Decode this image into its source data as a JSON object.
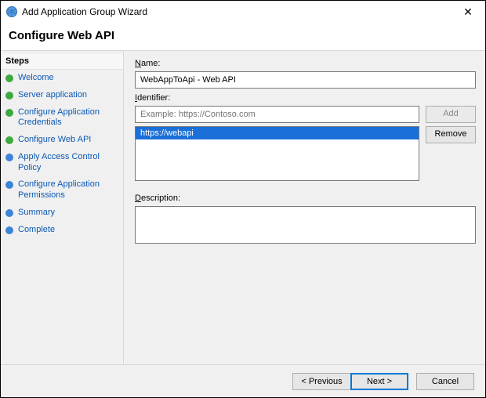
{
  "window": {
    "title": "Add Application Group Wizard",
    "close_glyph": "✕"
  },
  "heading": "Configure Web API",
  "sidebar": {
    "header": "Steps",
    "items": [
      {
        "label": "Welcome",
        "state": "done"
      },
      {
        "label": "Server application",
        "state": "done"
      },
      {
        "label": "Configure Application Credentials",
        "state": "done"
      },
      {
        "label": "Configure Web API",
        "state": "done"
      },
      {
        "label": "Apply Access Control Policy",
        "state": "pending"
      },
      {
        "label": "Configure Application Permissions",
        "state": "pending"
      },
      {
        "label": "Summary",
        "state": "pending"
      },
      {
        "label": "Complete",
        "state": "pending"
      }
    ]
  },
  "fields": {
    "name_label_prefix": "N",
    "name_label_rest": "ame:",
    "name_value": "WebAppToApi - Web API",
    "identifier_label_prefix": "I",
    "identifier_label_rest": "dentifier:",
    "identifier_placeholder": "Example: https://Contoso.com",
    "identifier_value": "",
    "identifier_items": [
      "https://webapi"
    ],
    "add_label": "Add",
    "remove_label": "Remove",
    "description_label_prefix": "D",
    "description_label_rest": "escription:",
    "description_value": ""
  },
  "footer": {
    "previous": "< Previous",
    "next": "Next >",
    "cancel": "Cancel"
  }
}
